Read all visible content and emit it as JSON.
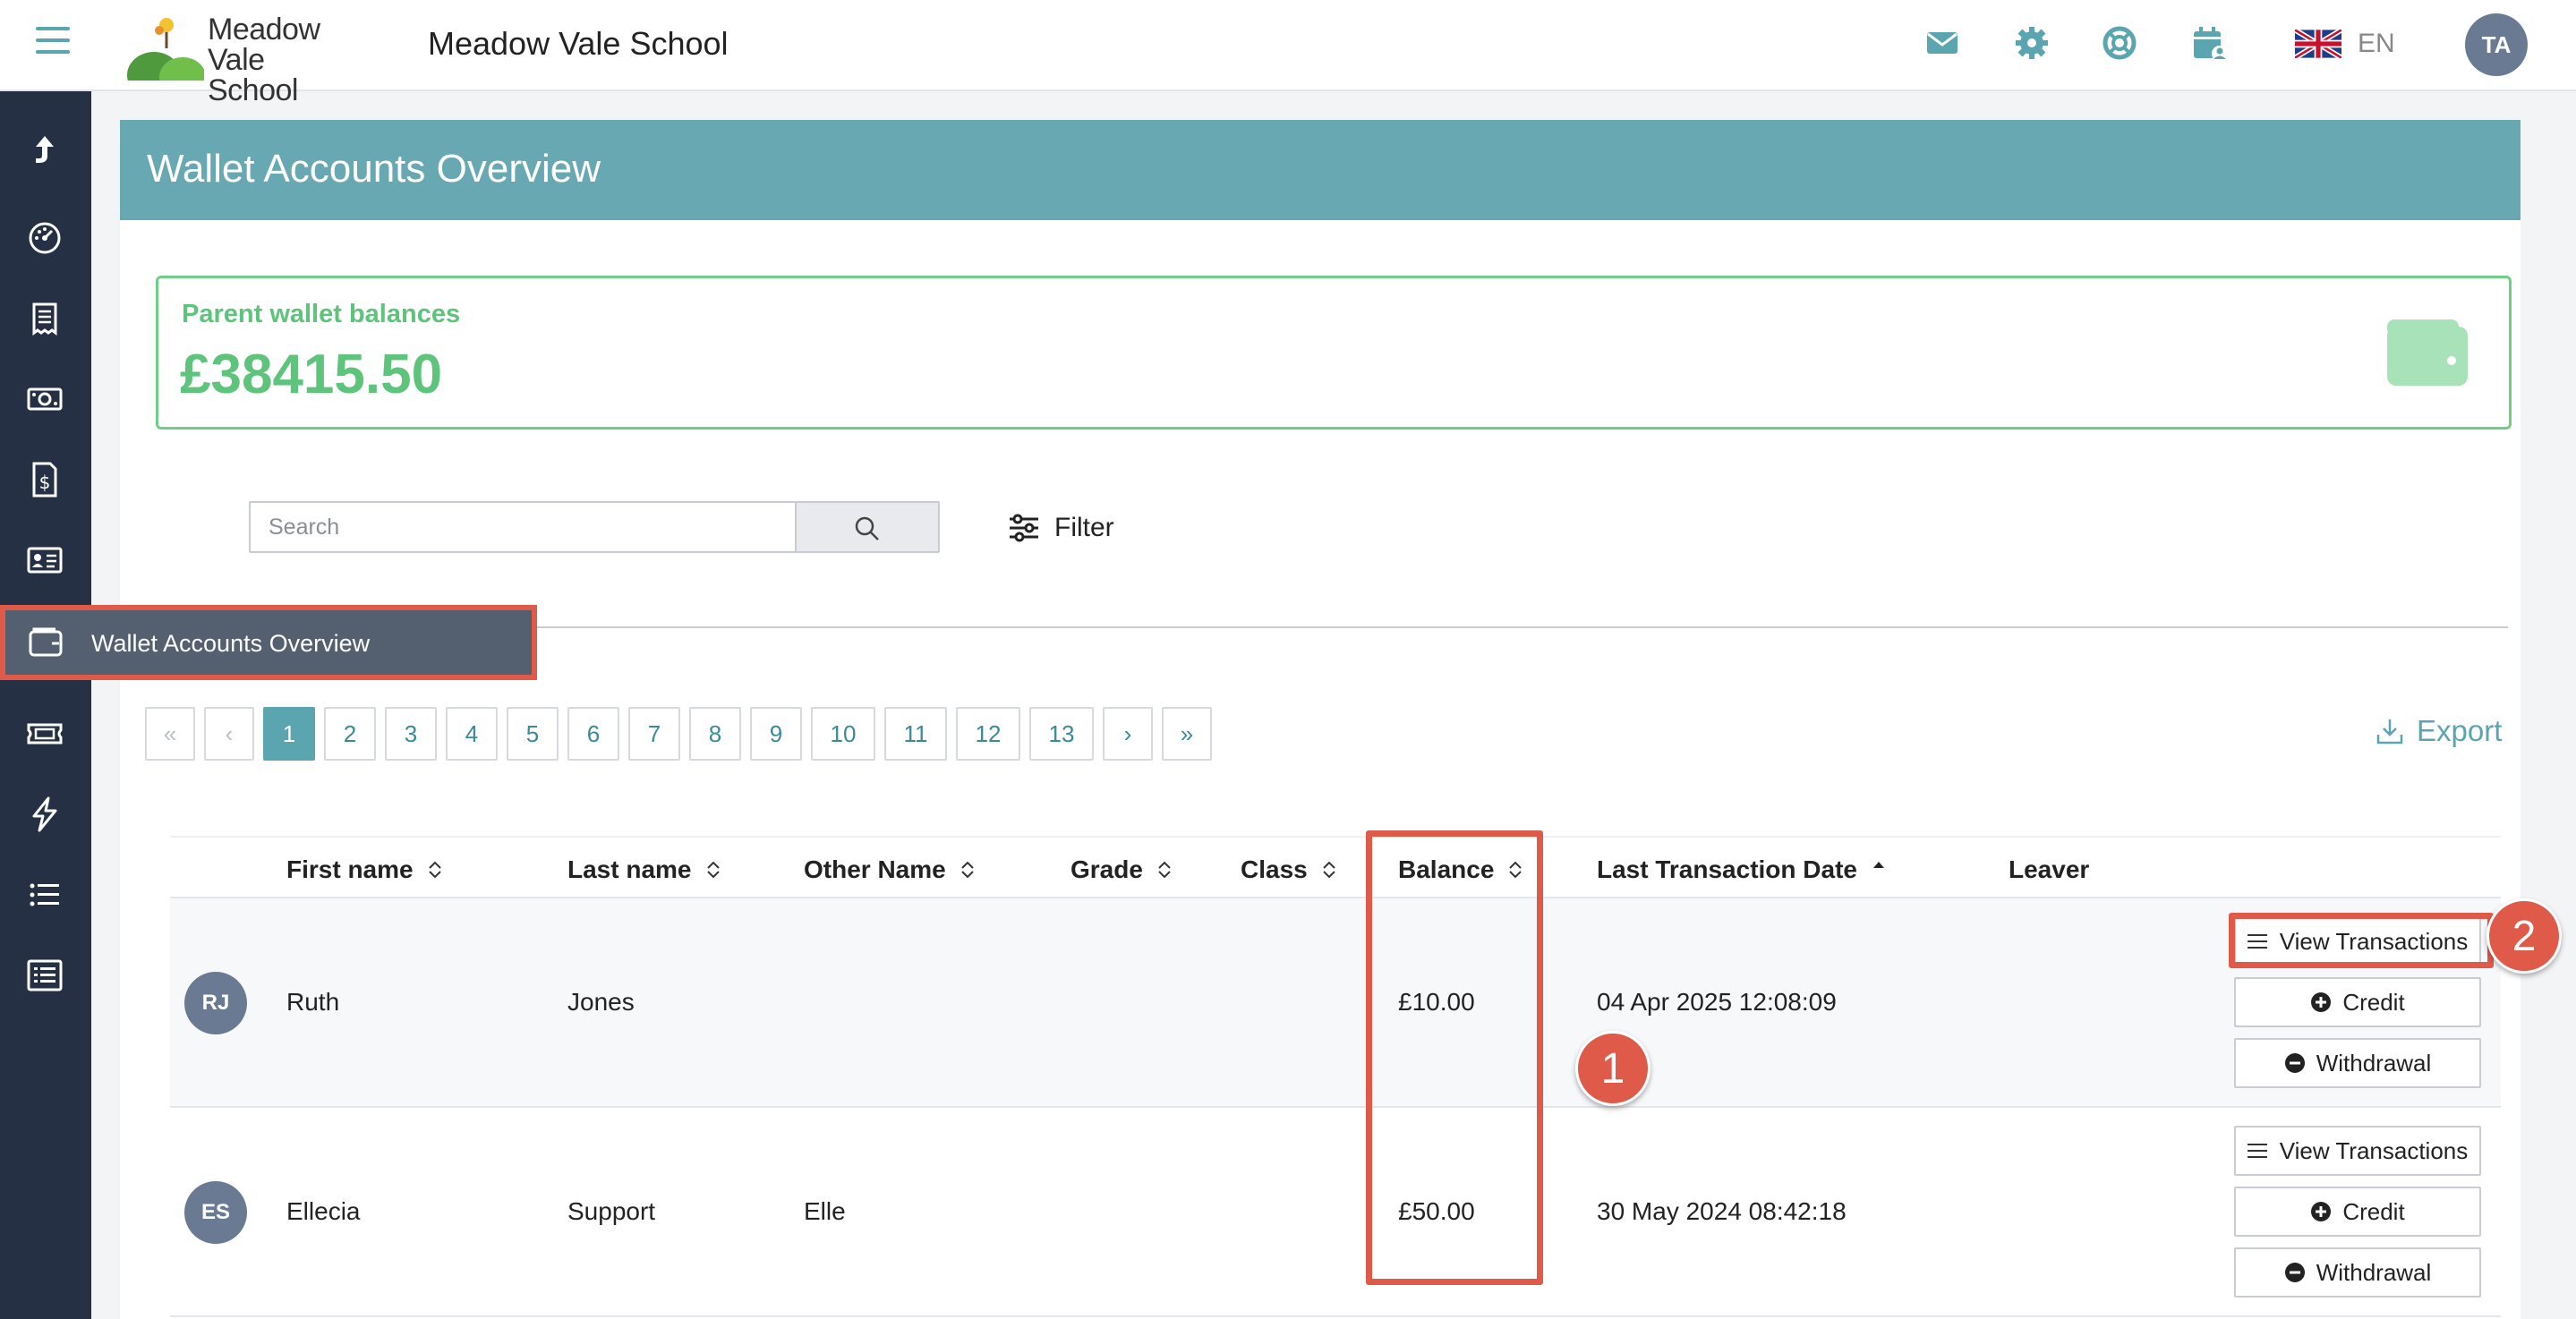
{
  "header": {
    "logo_text": "Meadow Vale School",
    "school_name": "Meadow Vale School",
    "icons": [
      "mail-icon",
      "settings-icon",
      "support-icon",
      "calendar-user-icon"
    ],
    "language": {
      "flag": "uk-flag-icon",
      "code": "EN"
    },
    "user_initials": "TA"
  },
  "sidebar": {
    "items": [
      "switch-icon",
      "dashboard-icon",
      "receipt-icon",
      "cash-icon",
      "dollar-document-icon",
      "id-card-icon",
      "wallet-icon",
      "ticket-icon",
      "lightning-icon",
      "list-icon",
      "detail-list-icon"
    ],
    "tooltip_label": "Wallet Accounts Overview"
  },
  "page": {
    "title": "Wallet Accounts Overview",
    "balance_label": "Parent wallet balances",
    "balance_value": "£38415.50"
  },
  "search": {
    "placeholder": "Search"
  },
  "filter_label": "Filter",
  "export_label": "Export",
  "pagination": {
    "first": "«",
    "prev": "‹",
    "pages": [
      "1",
      "2",
      "3",
      "4",
      "5",
      "6",
      "7",
      "8",
      "9",
      "10",
      "11",
      "12",
      "13"
    ],
    "current": "1",
    "next": "›",
    "last": "»"
  },
  "table": {
    "columns": [
      "First name",
      "Last name",
      "Other Name",
      "Grade",
      "Class",
      "Balance",
      "Last Transaction Date",
      "Leaver"
    ],
    "rows": [
      {
        "initials": "RJ",
        "first_name": "Ruth",
        "last_name": "Jones",
        "other_name": "",
        "grade": "",
        "class": "",
        "balance": "£10.00",
        "last_transaction": "04 Apr 2025 12:08:09",
        "leaver": ""
      },
      {
        "initials": "ES",
        "first_name": "Ellecia",
        "last_name": "Support",
        "other_name": "Elle",
        "grade": "",
        "class": "",
        "balance": "£50.00",
        "last_transaction": "30 May 2024 08:42:18",
        "leaver": ""
      }
    ],
    "actions": {
      "view_transactions": "View Transactions",
      "credit": "Credit",
      "withdrawal": "Withdrawal"
    }
  },
  "annotations": [
    "1",
    "2"
  ],
  "colors": {
    "accent": "#5aa5b0",
    "header_band": "#67a8b2",
    "sidebar": "#253044",
    "success": "#5ec47c",
    "annotation": "#e05a4a"
  }
}
